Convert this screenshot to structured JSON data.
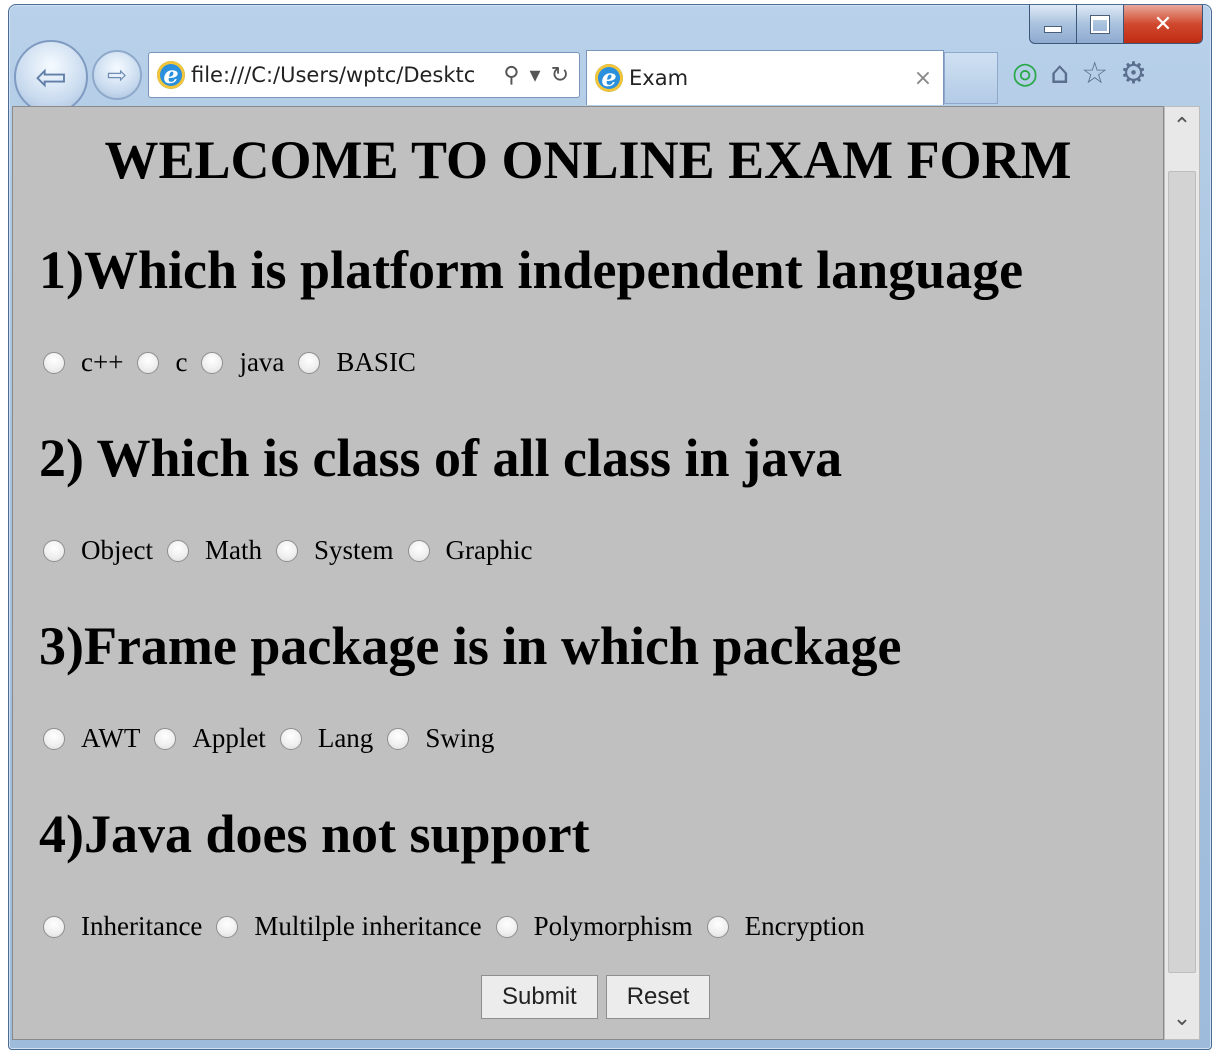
{
  "browser": {
    "address_url": "file:///C:/Users/wptc/Desktc",
    "tab_title": "Exam",
    "tab_close": "×"
  },
  "page": {
    "title": "WELCOME TO ONLINE EXAM FORM",
    "questions": [
      {
        "text": "1)Which is platform independent language",
        "options": [
          "c++",
          "c",
          "java",
          "BASIC"
        ]
      },
      {
        "text": "2) Which is class of all class in java",
        "options": [
          "Object",
          "Math",
          "System",
          "Graphic"
        ]
      },
      {
        "text": "3)Frame package is in which package",
        "options": [
          "AWT",
          "Applet",
          "Lang",
          "Swing"
        ]
      },
      {
        "text": "4)Java does not support",
        "options": [
          "Inheritance",
          "Multilple inheritance",
          "Polymorphism",
          "Encryption"
        ]
      }
    ],
    "submit_label": "Submit",
    "reset_label": "Reset"
  },
  "icons": [
    "back-icon",
    "forward-icon",
    "ie-logo-icon",
    "search-icon",
    "refresh-icon",
    "addon-icon",
    "home-icon",
    "favorites-icon",
    "settings-icon",
    "close-icon",
    "scroll-up-icon",
    "scroll-down-icon"
  ]
}
